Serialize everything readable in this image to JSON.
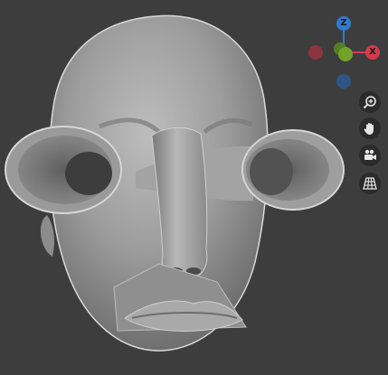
{
  "viewport": {
    "background": "#3d3d3d",
    "model": "sculpted-head-mesh"
  },
  "gizmo": {
    "z_label": "Z",
    "x_label": "X",
    "colors": {
      "z": "#2e7bcf",
      "x": "#d53a4a",
      "y": "#6fa32b",
      "neg_x": "#a8323f",
      "neg_z": "#2a5a94"
    }
  },
  "tools": [
    {
      "name": "zoom-icon"
    },
    {
      "name": "hand-icon"
    },
    {
      "name": "camera-icon"
    },
    {
      "name": "grid-icon"
    }
  ]
}
